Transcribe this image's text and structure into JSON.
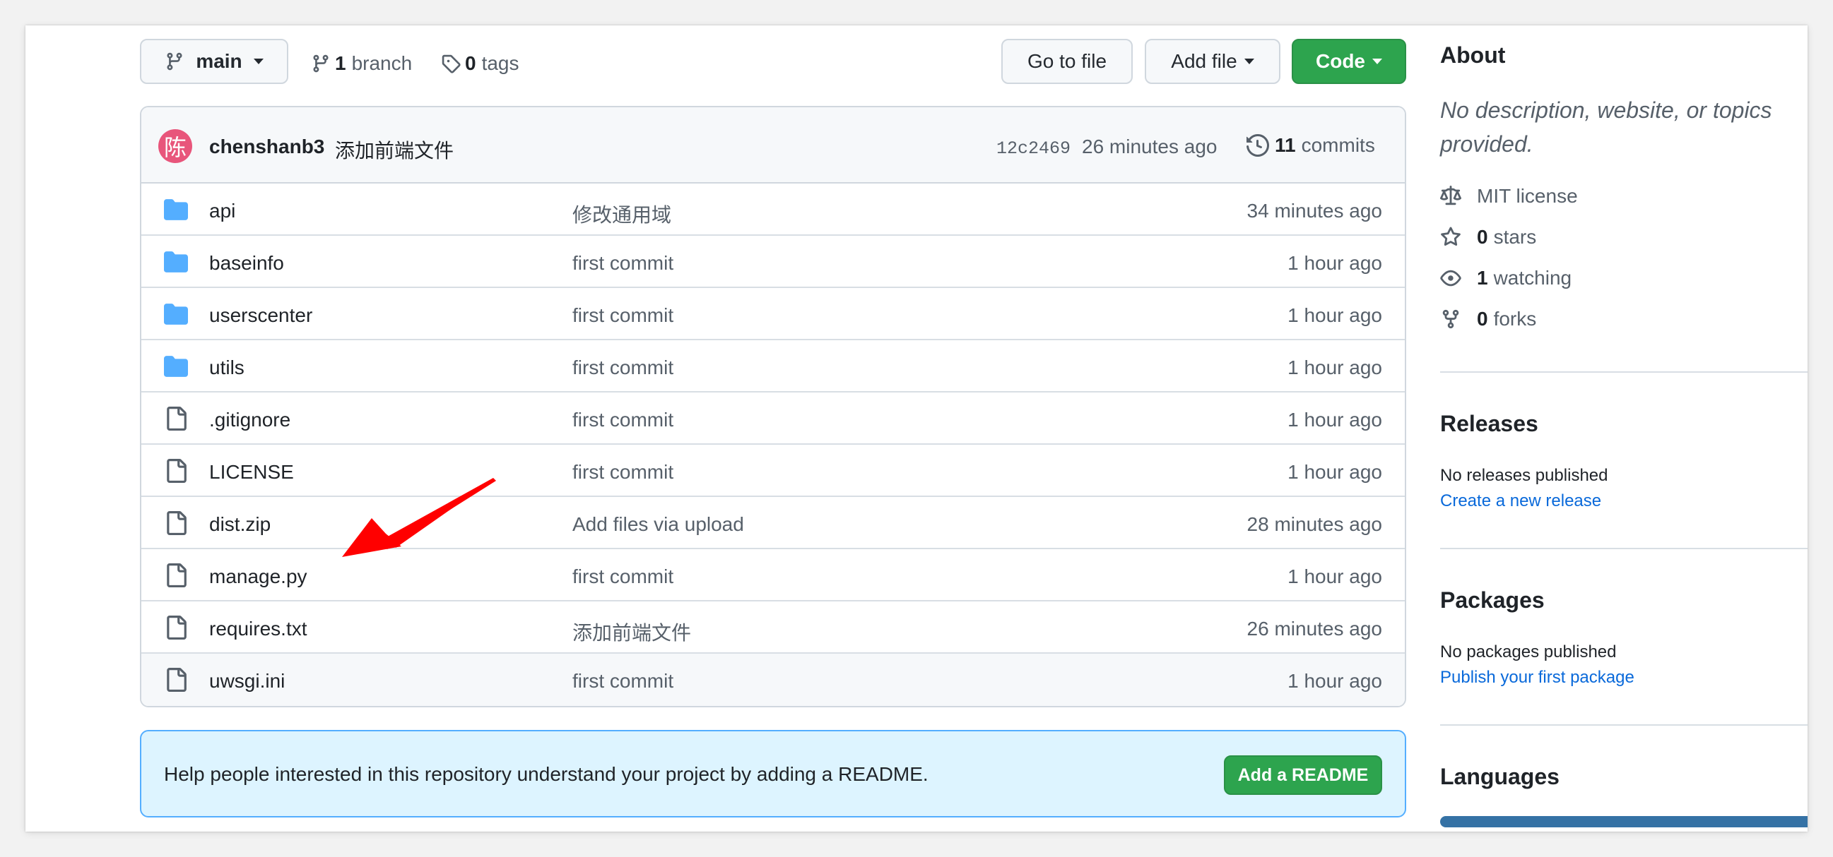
{
  "toolbar": {
    "branch_label": "main",
    "branches_count": "1",
    "branches_label": "branch",
    "tags_count": "0",
    "tags_label": "tags",
    "go_to_file": "Go to file",
    "add_file": "Add file",
    "code": "Code"
  },
  "latest_commit": {
    "avatar_char": "陈",
    "author": "chenshanb3",
    "message": "添加前端文件",
    "sha": "12c2469",
    "time": "26 minutes ago",
    "commits_count": "11",
    "commits_label": "commits"
  },
  "files": [
    {
      "type": "folder",
      "name": "api",
      "message": "修改通用域",
      "age": "34 minutes ago"
    },
    {
      "type": "folder",
      "name": "baseinfo",
      "message": "first commit",
      "age": "1 hour ago"
    },
    {
      "type": "folder",
      "name": "userscenter",
      "message": "first commit",
      "age": "1 hour ago"
    },
    {
      "type": "folder",
      "name": "utils",
      "message": "first commit",
      "age": "1 hour ago"
    },
    {
      "type": "file",
      "name": ".gitignore",
      "message": "first commit",
      "age": "1 hour ago"
    },
    {
      "type": "file",
      "name": "LICENSE",
      "message": "first commit",
      "age": "1 hour ago"
    },
    {
      "type": "file",
      "name": "dist.zip",
      "message": "Add files via upload",
      "age": "28 minutes ago"
    },
    {
      "type": "file",
      "name": "manage.py",
      "message": "first commit",
      "age": "1 hour ago"
    },
    {
      "type": "file",
      "name": "requires.txt",
      "message": "添加前端文件",
      "age": "26 minutes ago"
    },
    {
      "type": "file",
      "name": "uwsgi.ini",
      "message": "first commit",
      "age": "1 hour ago"
    }
  ],
  "readme_banner": {
    "text": "Help people interested in this repository understand your project by adding a README.",
    "button": "Add a README"
  },
  "sidebar": {
    "about_title": "About",
    "about_desc": "No description, website, or topics provided.",
    "license": "MIT license",
    "stars_count": "0",
    "stars_label": "stars",
    "watching_count": "1",
    "watching_label": "watching",
    "forks_count": "0",
    "forks_label": "forks",
    "releases_title": "Releases",
    "releases_note": "No releases published",
    "releases_link": "Create a new release",
    "packages_title": "Packages",
    "packages_note": "No packages published",
    "packages_link": "Publish your first package",
    "languages_title": "Languages"
  },
  "colors": {
    "primary_green": "#2da44e",
    "folder_blue": "#54aeff",
    "link_blue": "#0969da",
    "annotation_red": "#ff0000",
    "language_bar": "#3572a5"
  }
}
